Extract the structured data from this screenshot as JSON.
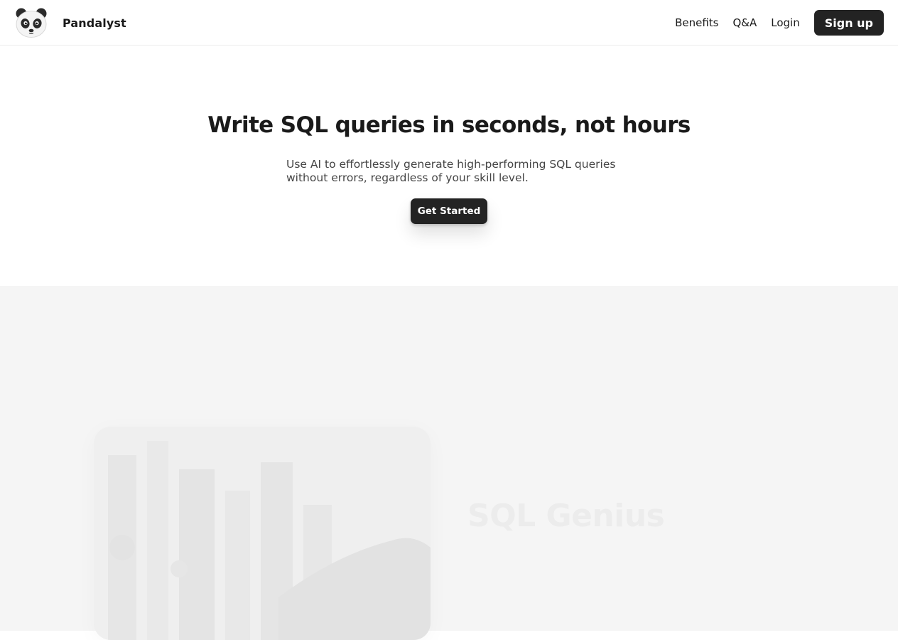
{
  "header": {
    "brand_name": "Pandalyst",
    "logo_icon": "panda-icon",
    "nav": {
      "benefits": "Benefits",
      "qa": "Q&A",
      "login": "Login",
      "signup": "Sign up"
    }
  },
  "hero": {
    "title": "Write SQL queries in seconds, not hours",
    "subtitle": "Use AI to effortlessly generate high-performing SQL queries without errors, regardless of your skill level.",
    "cta": "Get Started"
  },
  "features": {
    "title": "SQL Genius"
  },
  "colors": {
    "primary_button": "#232323",
    "features_background": "#f5f5f5"
  }
}
